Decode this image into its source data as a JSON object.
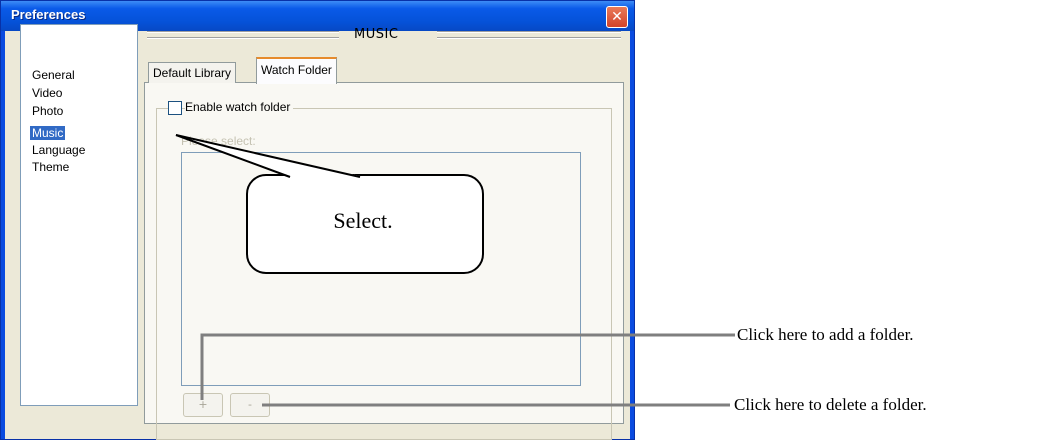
{
  "window": {
    "title": "Preferences",
    "close_glyph": "✕",
    "close_icon": "close-icon"
  },
  "categories": [
    {
      "label": "General",
      "selected": false
    },
    {
      "label": "Video",
      "selected": false
    },
    {
      "label": "Photo",
      "selected": false
    },
    {
      "label": "Music",
      "selected": true
    },
    {
      "label": "Language",
      "selected": false
    },
    {
      "label": "Theme",
      "selected": false
    }
  ],
  "section": {
    "title": "MUSIC"
  },
  "tabs": [
    {
      "label": "Default Library",
      "active": false
    },
    {
      "label": "Watch Folder",
      "active": true
    }
  ],
  "watch_folder": {
    "enable_label": "Enable watch folder",
    "enabled": false,
    "hint": "Please select:",
    "add_button": "+",
    "remove_button": "-"
  },
  "callout": {
    "text": "Select."
  },
  "annotations": {
    "add": "Click here to add a folder.",
    "delete": "Click here to delete a folder."
  },
  "colors": {
    "titlebar": "#0a5ae8",
    "selection": "#316ac5",
    "tab_highlight": "#e68b2c"
  }
}
